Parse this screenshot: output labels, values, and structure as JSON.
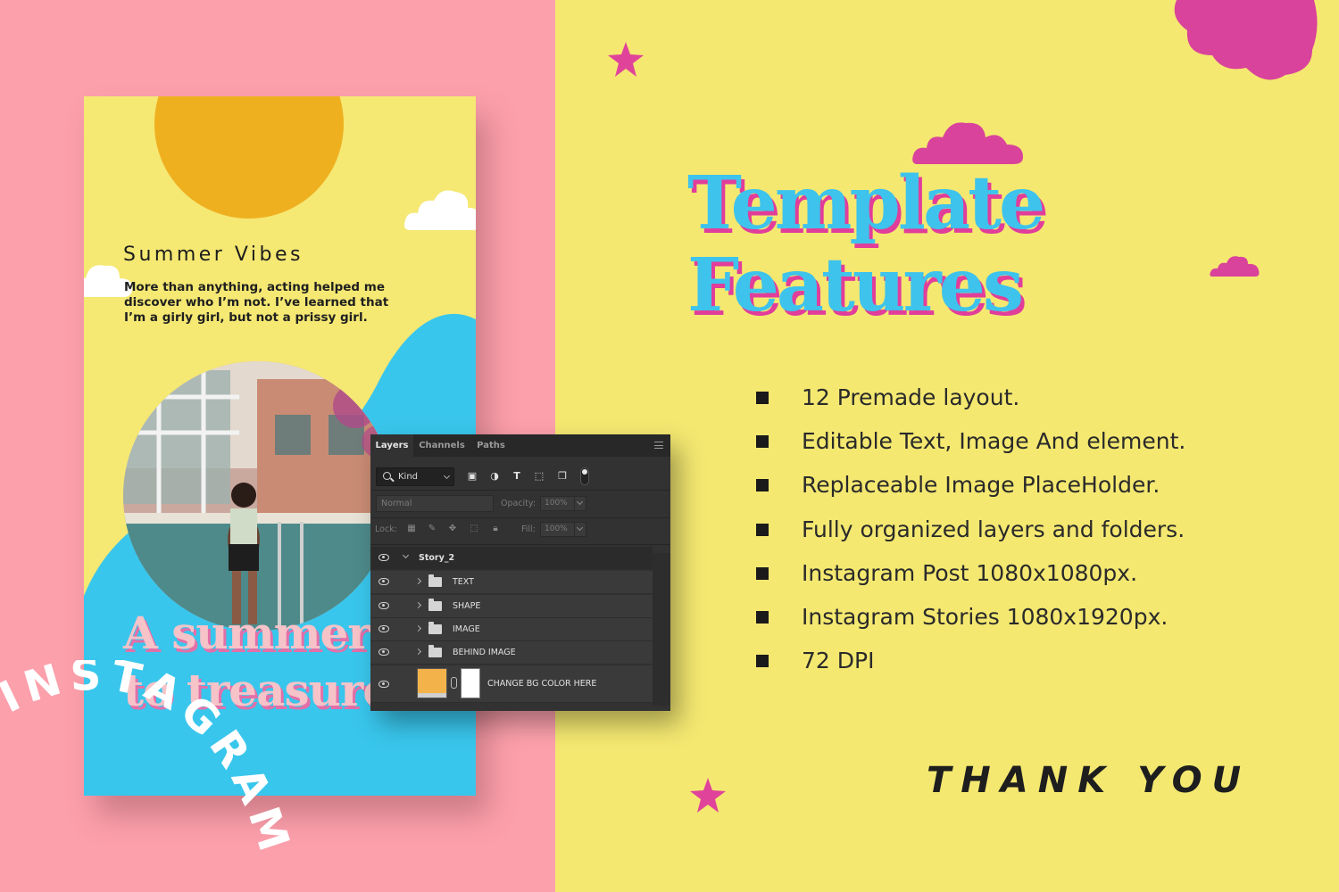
{
  "story": {
    "title": "Summer Vibes",
    "body": "More than anything, acting helped me discover who I’m not. I’ve learned that I’m a girly girl, but not a prissy girl.",
    "headline_lines": [
      "A summer",
      "to treasure."
    ],
    "arc_text": "INSTAGRAM"
  },
  "layers_panel": {
    "tabs": [
      "Layers",
      "Channels",
      "Paths"
    ],
    "active_tab": "Layers",
    "filter_kind": "Kind",
    "blend_mode": "Normal",
    "opacity_label": "Opacity:",
    "opacity_value": "100%",
    "lock_label": "Lock:",
    "fill_label": "Fill:",
    "fill_value": "100%",
    "root_group": "Story_2",
    "groups": [
      "TEXT",
      "SHAPE",
      "IMAGE",
      "BEHIND IMAGE"
    ],
    "bg_layer": "CHANGE BG COLOR HERE",
    "bg_layer_color": "#f4b34a"
  },
  "features": {
    "title_line1": "Template",
    "title_line2": "Features",
    "items": [
      "12 Premade layout.",
      "Editable Text, Image And element.",
      "Replaceable Image PlaceHolder.",
      "Fully organized layers and folders.",
      "Instagram Post 1080x1080px.",
      "Instagram Stories 1080x1920px.",
      "72 DPI"
    ]
  },
  "footer": {
    "thank_you": "THANK YOU"
  },
  "colors": {
    "left_bg": "#fca0ac",
    "right_bg": "#f4e871",
    "title_blue": "#3ec3ec",
    "accent_pink": "#e13d9a",
    "sun": "#efb020",
    "wave_blue": "#39c6ec"
  }
}
